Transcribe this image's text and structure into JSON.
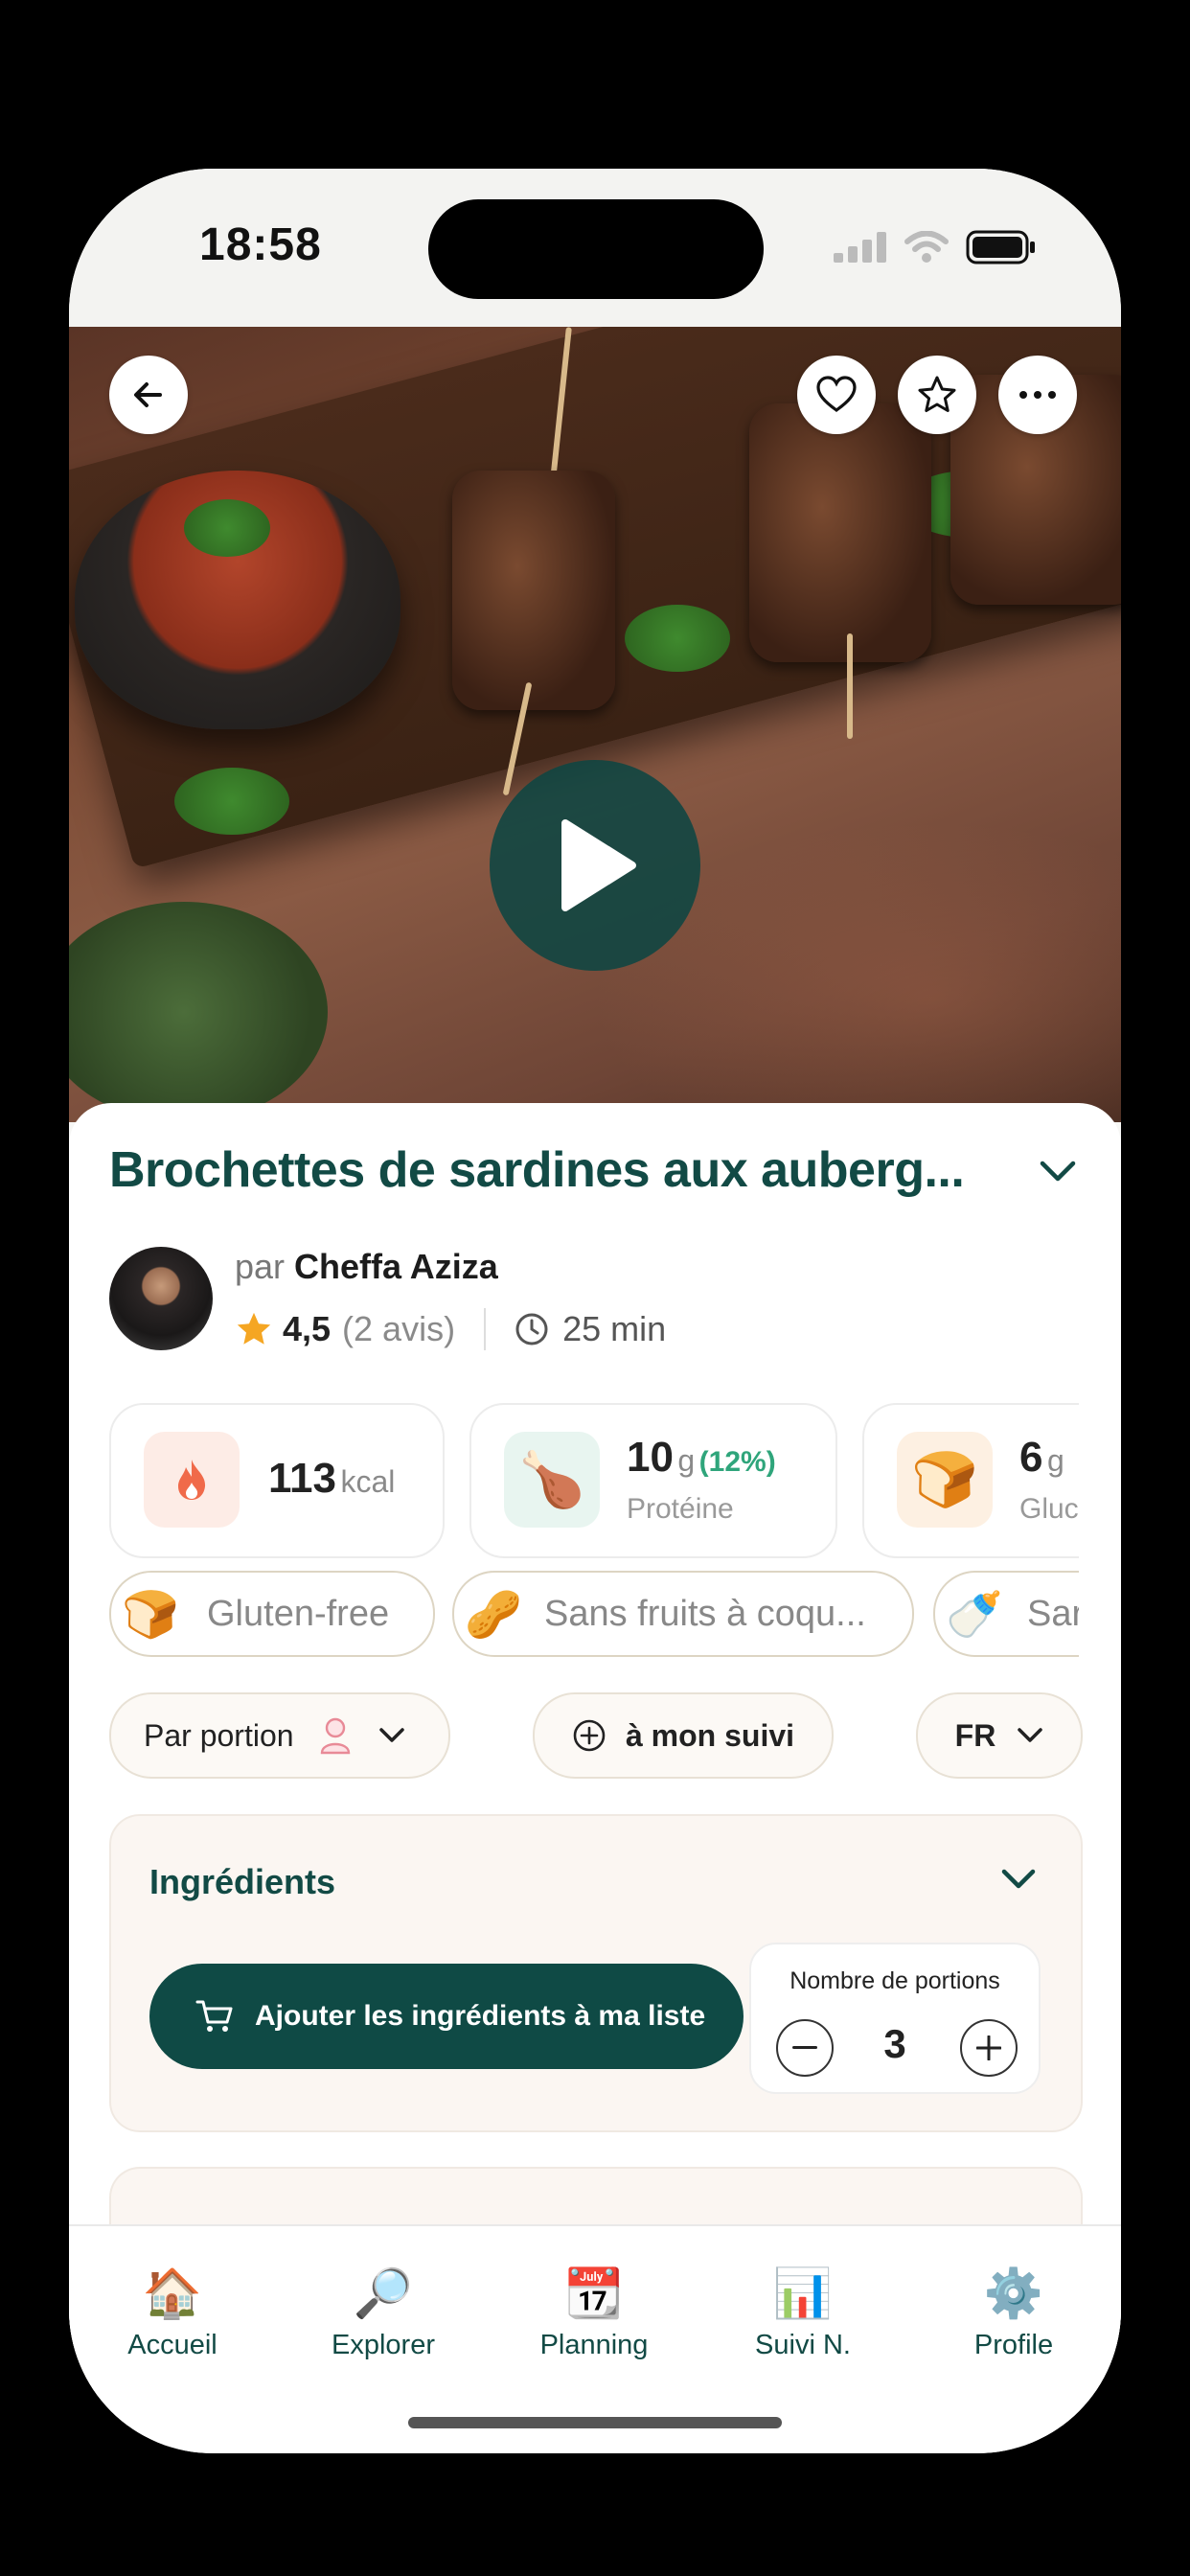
{
  "status_bar": {
    "time": "18:58"
  },
  "recipe": {
    "title": "Brochettes de sardines aux auberg...",
    "author_prefix": "par",
    "author_name": "Cheffa Aziza",
    "rating": "4,5",
    "reviews": "(2 avis)",
    "duration": "25 min"
  },
  "nutrition": [
    {
      "value": "113",
      "unit": "kcal",
      "label": "",
      "percent": "",
      "icon": "flame-icon"
    },
    {
      "value": "10",
      "unit": "g",
      "percent": "(12%)",
      "label": "Protéine",
      "icon": "chicken-leg-icon"
    },
    {
      "value": "6",
      "unit": "g",
      "percent": "",
      "label": "Gluc",
      "icon": "bread-icon"
    }
  ],
  "diet_tags": [
    {
      "label": "Gluten-free",
      "icon": "bread-icon"
    },
    {
      "label": "Sans fruits à coqu...",
      "icon": "nuts-icon"
    },
    {
      "label": "Sar",
      "icon": "milk-bottle-icon"
    }
  ],
  "controls": {
    "portion_mode": "Par portion",
    "track_label": "à mon suivi",
    "language": "FR"
  },
  "ingredients": {
    "heading": "Ingrédients",
    "add_to_list": "Ajouter les ingrédients à ma liste",
    "portions_label": "Nombre de portions",
    "portions_count": "3"
  },
  "tabs": [
    {
      "label": "Accueil",
      "icon": "house-icon"
    },
    {
      "label": "Explorer",
      "icon": "magnifier-icon"
    },
    {
      "label": "Planning",
      "icon": "calendar-icon"
    },
    {
      "label": "Suivi N.",
      "icon": "bar-chart-icon"
    },
    {
      "label": "Profile",
      "icon": "gear-icon"
    }
  ],
  "colors": {
    "brand": "#124a45",
    "button": "#0f4a45",
    "accent_green": "#2fa57b",
    "star": "#f5a623"
  }
}
